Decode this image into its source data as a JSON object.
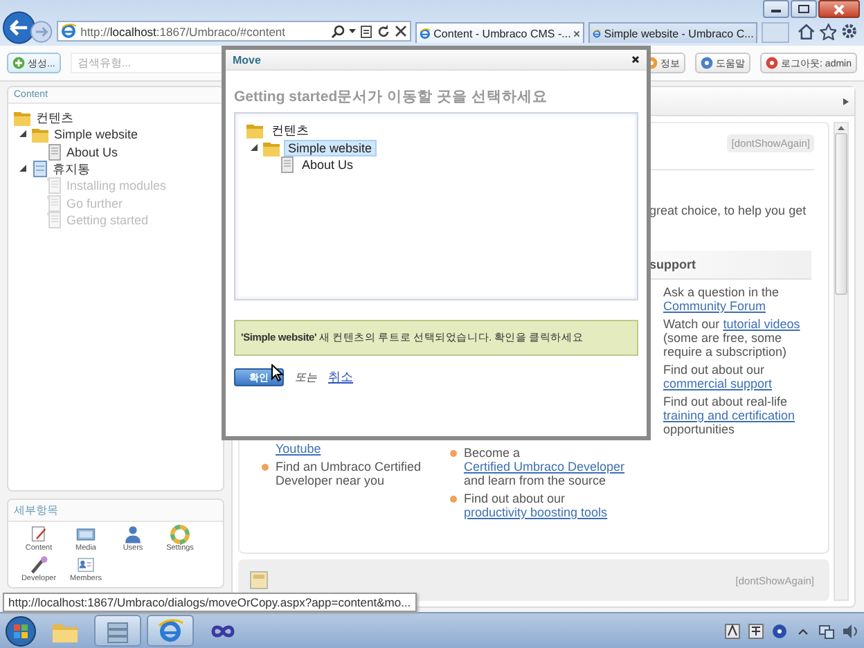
{
  "browser": {
    "address": "http://**localhost**:1867/Umbraco/#content",
    "tabs": [
      {
        "label": "Content - Umbraco CMS -...",
        "selected": true
      },
      {
        "label": "Simple website - Umbraco C...",
        "selected": false
      }
    ]
  },
  "toolbar": {
    "create_button": "생성...",
    "search": {
      "placeholder": "검색유형..."
    },
    "buttons": [
      {
        "label": "정보",
        "kind": "info"
      },
      {
        "label": "도움말",
        "kind": "help"
      },
      {
        "label": "로그아웃: admin",
        "kind": "logout"
      }
    ]
  },
  "content_tree": {
    "title": "Content",
    "items": [
      {
        "label": "컨텐츠",
        "kind": "folder",
        "disabled": false,
        "children": [
          {
            "label": "Simple website",
            "kind": "folder",
            "expanded": true,
            "disabled": false,
            "children": [
              {
                "label": "About Us",
                "kind": "document",
                "disabled": false
              }
            ]
          },
          {
            "label": "휴지통",
            "kind": "recycle-bin",
            "expanded": true,
            "disabled": false,
            "children": [
              {
                "label": "Installing modules",
                "kind": "document",
                "disabled": true
              },
              {
                "label": "Go further",
                "kind": "document",
                "disabled": true
              },
              {
                "label": "Getting started",
                "kind": "document",
                "disabled": true
              }
            ]
          }
        ]
      }
    ]
  },
  "sections": {
    "title": "세부항목",
    "items": [
      {
        "label": "Content",
        "kind": "content"
      },
      {
        "label": "Media",
        "kind": "media"
      },
      {
        "label": "Users",
        "kind": "users"
      },
      {
        "label": "Settings",
        "kind": "settings"
      },
      {
        "label": "Developer",
        "kind": "developer"
      },
      {
        "label": "Members",
        "kind": "members"
      }
    ]
  },
  "dashboard": {
    "welcome": {
      "dont_show_again": "[dontShowAgain]",
      "intro": "great choice, to help you get"
    },
    "support": {
      "title": "support",
      "items": [
        {
          "before": "Ask a question in the",
          "link": "Community Forum"
        },
        {
          "before": "Watch our",
          "link": "tutorial videos",
          "after": "(some are free, some require a subscription)"
        },
        {
          "before": "Find out about our",
          "link": "commercial support"
        },
        {
          "before": "Find out about real-life",
          "link": "training and certification",
          "after": "opportunities"
        }
      ]
    },
    "column_1": [
      {
        "kind": "continued",
        "link": "Youtube"
      },
      {
        "kind": "bullet",
        "before": "Find an Umbraco Certified Developer near you"
      }
    ],
    "column_2": [
      {
        "kind": "bullet",
        "before": "Become a",
        "link": "Certified Umbraco Developer",
        "after": "and learn from the source"
      },
      {
        "kind": "bullet",
        "before": "Find out about our",
        "link": "productivity boosting tools"
      }
    ],
    "next_box": {
      "dont_show_again": "[dontShowAgain]"
    }
  },
  "dialog": {
    "title": "Move",
    "prompt": "Getting started문서가 이동할 곳을 선택하세요",
    "tree": [
      {
        "label": "컨텐츠",
        "kind": "folder",
        "selected": false,
        "children": [
          {
            "label": "Simple website",
            "kind": "folder",
            "expanded": true,
            "selected": true,
            "children": [
              {
                "label": "About Us",
                "kind": "document",
                "selected": false
              }
            ]
          }
        ]
      }
    ],
    "message": "**'Simple website'** 새 컨텐츠의 루트로 선택되었습니다. 확인을 클릭하세요",
    "ok_button": "확인",
    "or": "또는",
    "cancel_link": "취소"
  },
  "status_url": "http://localhost:1867/Umbraco/dialogs/moveOrCopy.aspx?app=content&mo..."
}
